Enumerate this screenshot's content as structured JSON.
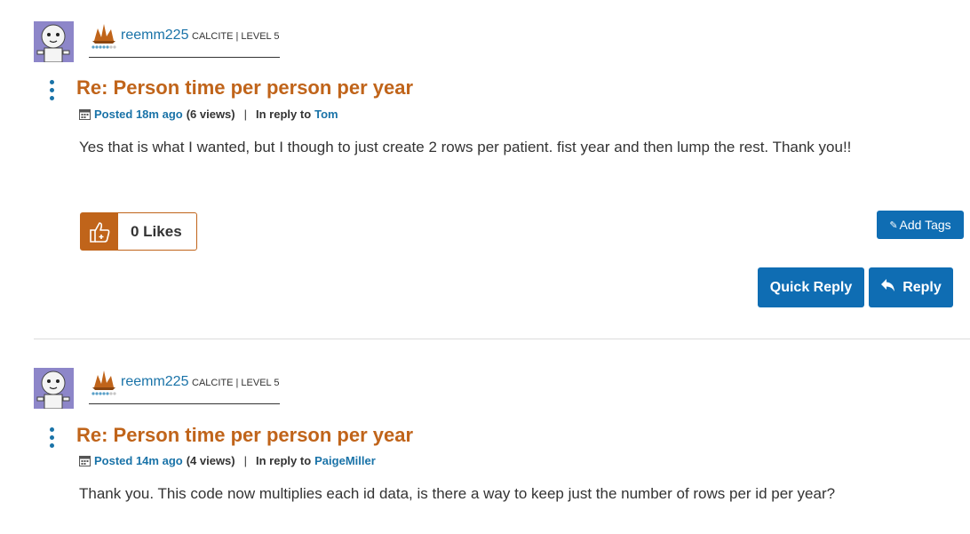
{
  "posts": [
    {
      "username": "reemm225",
      "rank": "CALCITE | LEVEL 5",
      "subject": "Re: Person time per person per year",
      "posted": "Posted 18m ago",
      "views": "(6 views)",
      "separator": "|",
      "in_reply_to_label": "In reply to",
      "in_reply_to_user": "Tom",
      "body": "Yes that is what I wanted, but I though to just create 2 rows per patient. fist year and then lump the rest. Thank you!!",
      "likes": "0 Likes",
      "add_tags": "Add Tags",
      "quick_reply": "Quick Reply",
      "reply": "Reply"
    },
    {
      "username": "reemm225",
      "rank": "CALCITE | LEVEL 5",
      "subject": "Re: Person time per person per year",
      "posted": "Posted 14m ago",
      "views": "(4 views)",
      "separator": "|",
      "in_reply_to_label": "In reply to",
      "in_reply_to_user": "PaigeMiller",
      "body": "Thank you. This code now multiplies each id data, is there a way to keep just the number of rows per id per year?"
    }
  ],
  "icons": {
    "avatar": "robot-avatar-icon",
    "rank": "crystal-rank-icon",
    "menu": "vertical-ellipsis-icon",
    "calendar": "calendar-icon",
    "like": "thumbs-up-icon",
    "tag": "tag-icon",
    "reply": "reply-arrow-icon"
  },
  "colors": {
    "accent_orange": "#c0641a",
    "link_blue": "#1a73a8",
    "button_blue": "#0f6db3"
  }
}
